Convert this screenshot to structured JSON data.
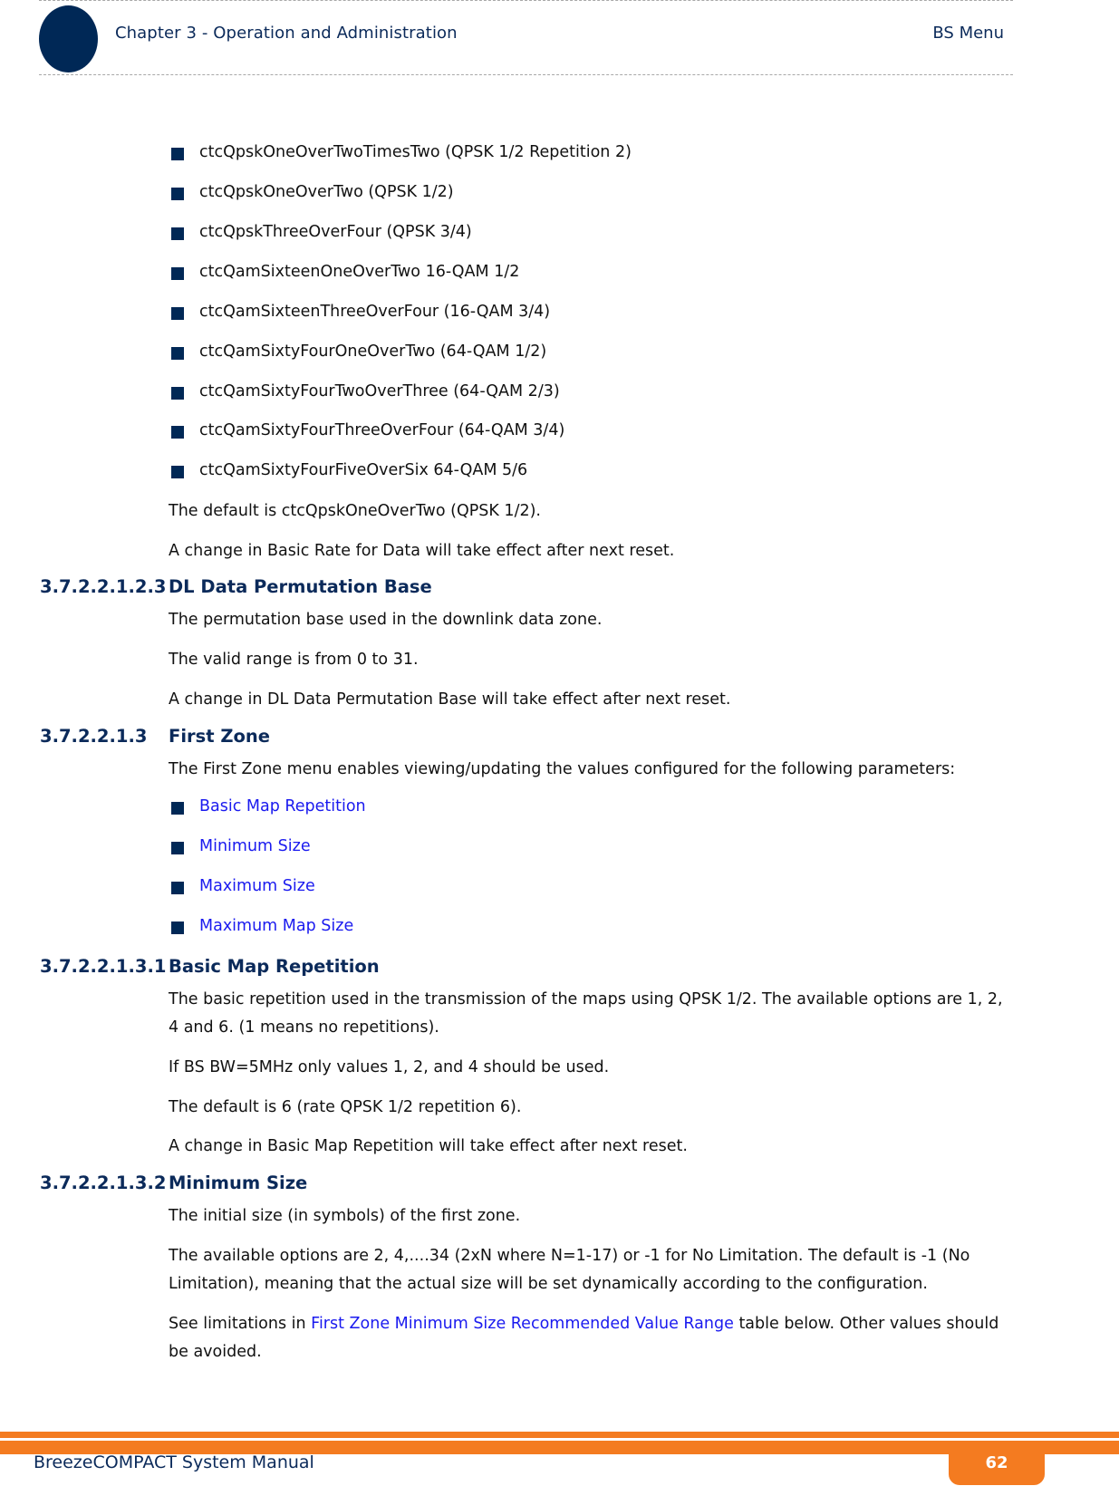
{
  "header": {
    "chapter": "Chapter 3 - Operation and Administration",
    "section": "BS Menu"
  },
  "rate_options": [
    "ctcQpskOneOverTwoTimesTwo (QPSK 1/2 Repetition 2)",
    "ctcQpskOneOverTwo (QPSK 1/2)",
    "ctcQpskThreeOverFour (QPSK 3/4)",
    "ctcQamSixteenOneOverTwo 16-QAM 1/2",
    "ctcQamSixteenThreeOverFour (16-QAM 3/4)",
    "ctcQamSixtyFourOneOverTwo (64-QAM 1/2)",
    "ctcQamSixtyFourTwoOverThree (64-QAM 2/3)",
    "ctcQamSixtyFourThreeOverFour (64-QAM 3/4)",
    "ctcQamSixtyFourFiveOverSix 64-QAM 5/6"
  ],
  "rate_default": "The default is ctcQpskOneOverTwo (QPSK 1/2).",
  "rate_reset_note": "A change in Basic Rate for Data will take effect after next reset.",
  "sections": {
    "dl_perm": {
      "number": "3.7.2.2.1.2.3",
      "title": "DL Data Permutation Base",
      "p1": "The permutation base used in the downlink data zone.",
      "p2": "The valid range is from 0 to 31.",
      "p3": "A change in DL Data Permutation Base will take effect after next reset."
    },
    "first_zone": {
      "number": "3.7.2.2.1.3",
      "title": "First Zone",
      "intro": "The First Zone menu enables viewing/updating the values configured for the following parameters:",
      "links": [
        "Basic Map Repetition",
        "Minimum Size",
        "Maximum Size",
        "Maximum Map Size"
      ]
    },
    "basic_map": {
      "number": "3.7.2.2.1.3.1",
      "title": "Basic Map Repetition",
      "p1a": "The basic repetition used in the transmission of the maps using QPSK 1/2. The available options are 1, 2,",
      "p1b": "4 and 6. (1 means no repetitions).",
      "p2": "If BS BW=5MHz only values 1, 2, and 4 should be used.",
      "p3": "The default is 6 (rate QPSK 1/2 repetition 6).",
      "p4": "A change in Basic Map Repetition will take effect after next reset."
    },
    "min_size": {
      "number": "3.7.2.2.1.3.2",
      "title": "Minimum Size",
      "p1": "The initial size (in symbols) of the first zone.",
      "p2a": "The available options are 2, 4,....34 (2xN where N=1-17) or -1 for No Limitation. The default is -1 (No",
      "p2b": "Limitation), meaning that the actual size will be set dynamically according to the configuration.",
      "p3_pre": "See limitations in ",
      "p3_link": "First Zone Minimum Size Recommended Value Range",
      "p3_post": " table below. Other values should",
      "p3b": "be avoided."
    }
  },
  "footer": {
    "title": "BreezeCOMPACT System Manual",
    "page_number": "62"
  },
  "colors": {
    "heading": "#0b2a5a",
    "bullet": "#002856",
    "link": "#1a1aef",
    "footer_accent": "#f47b20"
  }
}
